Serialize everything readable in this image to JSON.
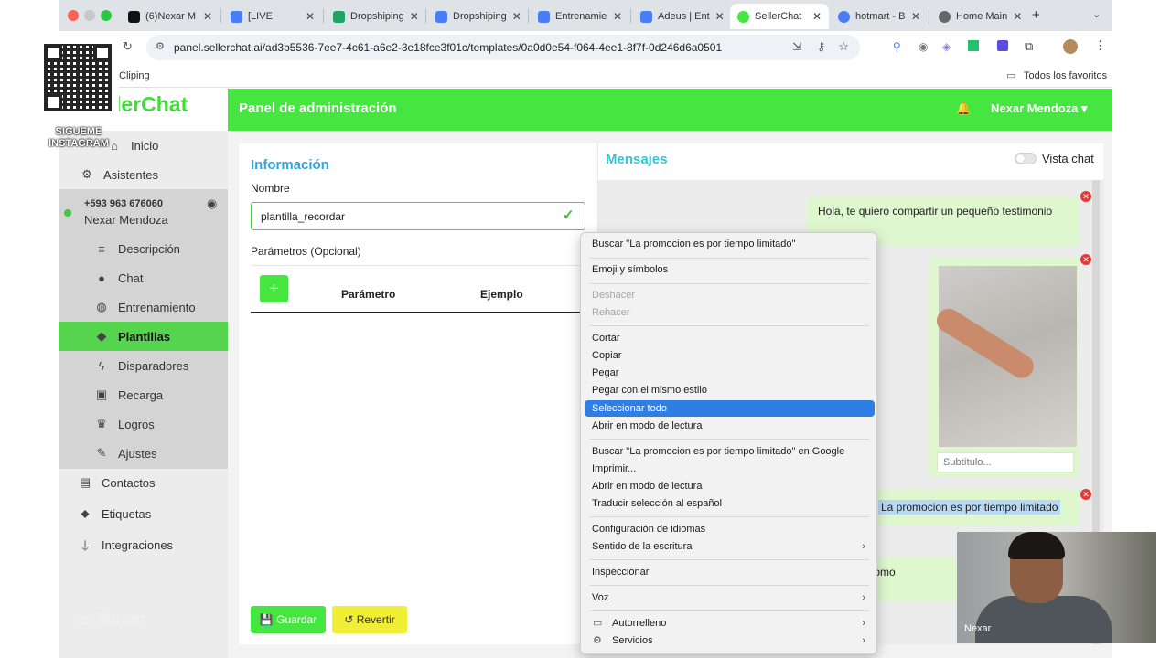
{
  "browser": {
    "tabs": [
      {
        "title": "(6)Nexar M",
        "color": "#111111"
      },
      {
        "title": "[LIVE",
        "color": "#4a7cf5"
      },
      {
        "title": "Dropshiping",
        "color": "#1ea362"
      },
      {
        "title": "Dropshiping",
        "color": "#4a7cf5"
      },
      {
        "title": "Entrenamie",
        "color": "#4a7cf5"
      },
      {
        "title": "Adeus | Ent",
        "color": "#4a7cf5"
      },
      {
        "title": "SellerChat",
        "color": "#46e640"
      },
      {
        "title": "hotmart - B",
        "color": "#4a7cf5"
      },
      {
        "title": "Home Main",
        "color": "#666666"
      }
    ],
    "url": "panel.sellerchat.ai/ad3b5536-7ee7-4c61-a6e2-3e18fce3f01c/templates/0a0d0e54-f064-4ee1-8f7f-0d246d6a0501",
    "bookmark": "Cliping",
    "all_bookmarks": "Todos los favoritos"
  },
  "brand": "lerChat",
  "header": {
    "title": "Panel de administración",
    "user": "Nexar Mendoza"
  },
  "sidebar": {
    "inicio": "Inicio",
    "asistentes": "Asistentes",
    "phone": "+593 963 676060",
    "account_name": "Nexar Mendoza",
    "items": [
      {
        "label": "Descripción",
        "icon": "list-icon"
      },
      {
        "label": "Chat",
        "icon": "chat-icon"
      },
      {
        "label": "Entrenamiento",
        "icon": "brain-icon"
      },
      {
        "label": "Plantillas",
        "icon": "layers-icon"
      },
      {
        "label": "Disparadores",
        "icon": "bolt-icon"
      },
      {
        "label": "Recarga",
        "icon": "money-icon"
      },
      {
        "label": "Logros",
        "icon": "trophy-icon"
      },
      {
        "label": "Ajustes",
        "icon": "wrench-icon"
      }
    ],
    "contactos": "Contactos",
    "etiquetas": "Etiquetas",
    "integraciones": "Integraciones",
    "watermark": "Nexar"
  },
  "form": {
    "heading": "Información",
    "name_label": "Nombre",
    "name_value": "plantilla_recordar",
    "params_label": "Parámetros (Opcional)",
    "add_label": "+",
    "col_param": "Parámetro",
    "col_example": "Ejemplo",
    "save": "Guardar",
    "revert": "Revertir"
  },
  "messages": {
    "heading": "Mensajes",
    "toggle_label": "Vista chat",
    "msg1": "Hola, te quiero compartir un pequeño testimonio",
    "subtitle_placeholder": "Subtítulo...",
    "msg3": "La promocion es por tiempo limitado",
    "msg4": "conque promo"
  },
  "context_menu": {
    "items": [
      {
        "label": "Buscar \"La promocion es por tiempo limitado\"",
        "state": "normal"
      },
      {
        "label": "Emoji y símbolos",
        "state": "normal"
      },
      {
        "label": "Deshacer",
        "state": "disabled"
      },
      {
        "label": "Rehacer",
        "state": "disabled"
      },
      {
        "label": "Cortar",
        "state": "normal"
      },
      {
        "label": "Copiar",
        "state": "normal"
      },
      {
        "label": "Pegar",
        "state": "normal"
      },
      {
        "label": "Pegar con el mismo estilo",
        "state": "normal"
      },
      {
        "label": "Seleccionar todo",
        "state": "highlighted"
      },
      {
        "label": "Abrir en modo de lectura",
        "state": "normal"
      },
      {
        "label": "Buscar \"La promocion es por tiempo limitado\" en Google",
        "state": "normal"
      },
      {
        "label": "Imprimir...",
        "state": "normal"
      },
      {
        "label": "Abrir en modo de lectura",
        "state": "normal"
      },
      {
        "label": "Traducir selección al español",
        "state": "normal"
      },
      {
        "label": "Configuración de idiomas",
        "state": "normal"
      },
      {
        "label": "Sentido de la escritura",
        "state": "submenu"
      },
      {
        "label": "Inspeccionar",
        "state": "normal"
      },
      {
        "label": "Voz",
        "state": "submenu"
      },
      {
        "label": "Autorrelleno",
        "state": "submenu"
      },
      {
        "label": "Servicios",
        "state": "submenu"
      }
    ]
  },
  "overlay": {
    "qr_caption": "SIGUEME INSTAGRAM",
    "cam_name": "Nexar"
  },
  "colors": {
    "accent": "#46e640",
    "heading_blue": "#35a4d6",
    "highlight": "#2f7ee6"
  }
}
